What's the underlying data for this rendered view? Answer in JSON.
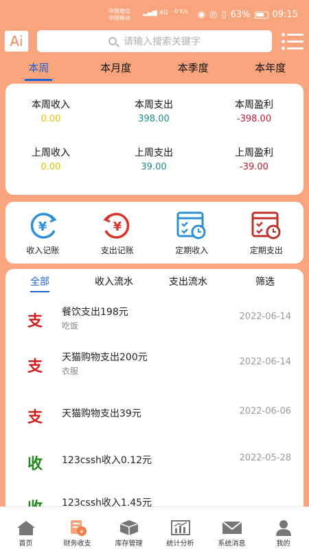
{
  "status": {
    "carrier1": "中国电信",
    "carrier2": "中国移动",
    "net": "4G",
    "speed": "0 K/s",
    "battery": "63%",
    "time": "09:15"
  },
  "topbar": {
    "logo": "Ai",
    "search_placeholder": "请输入搜索关键字"
  },
  "period_tabs": [
    "本周",
    "本月度",
    "本季度",
    "本年度"
  ],
  "summary": {
    "this_week": [
      {
        "label": "本周收入",
        "value": "0.00"
      },
      {
        "label": "本周支出",
        "value": "398.00"
      },
      {
        "label": "本周盈利",
        "value": "-398.00"
      }
    ],
    "last_week": [
      {
        "label": "上周收入",
        "value": "0.00"
      },
      {
        "label": "上周支出",
        "value": "39.00"
      },
      {
        "label": "上周盈利",
        "value": "-39.00"
      }
    ]
  },
  "actions": [
    {
      "label": "收入记账",
      "icon": "income-record-icon"
    },
    {
      "label": "支出记账",
      "icon": "expense-record-icon"
    },
    {
      "label": "定期收入",
      "icon": "scheduled-income-icon"
    },
    {
      "label": "定期支出",
      "icon": "scheduled-expense-icon"
    }
  ],
  "flow_tabs": [
    "全部",
    "收入流水",
    "支出流水",
    "筛选"
  ],
  "records": [
    {
      "glyph": "支",
      "title": "餐饮支出198元",
      "category": "吃饭",
      "date": "2022-06-14"
    },
    {
      "glyph": "支",
      "title": "天猫购物支出200元",
      "category": "衣服",
      "date": "2022-06-14"
    },
    {
      "glyph": "支",
      "title": "天猫购物支出39元",
      "category": "",
      "date": "2022-06-06"
    },
    {
      "glyph": "收",
      "title": "123cssh收入0.12元",
      "category": "",
      "date": "2022-05-28"
    },
    {
      "glyph": "收",
      "title": "123cssh收入1.45元",
      "category": "",
      "date": ""
    }
  ],
  "bottom_nav": [
    "首页",
    "财务收支",
    "库存管理",
    "统计分析",
    "系统消息",
    "我的"
  ],
  "colors": {
    "accent": "#f8a47c",
    "active_tab": "#1d5fd6",
    "income_yellow": "#e8c100",
    "expense_teal": "#1a8f8a",
    "profit_red": "#c01a2a"
  }
}
